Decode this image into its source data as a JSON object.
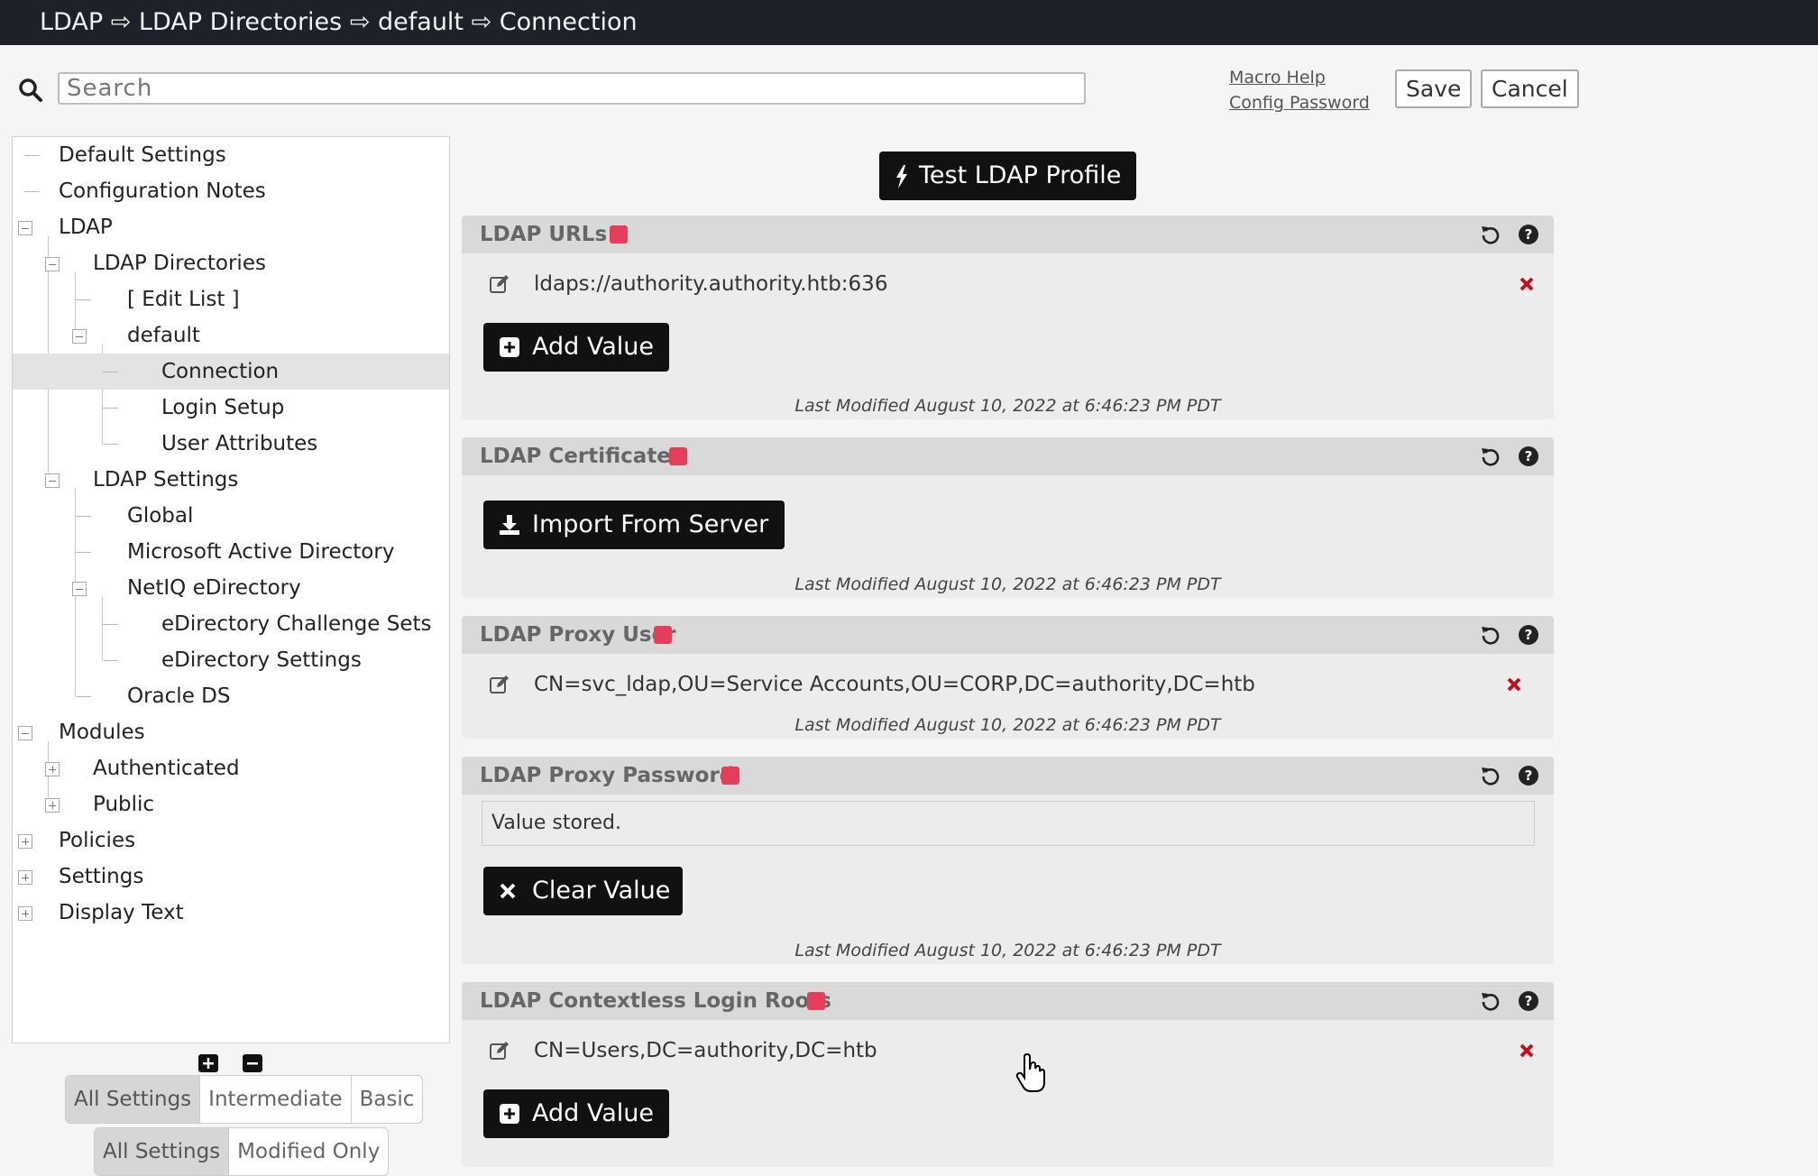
{
  "breadcrumb": "LDAP ⇨ LDAP Directories ⇨ default ⇨ Connection",
  "search": {
    "placeholder": "Search"
  },
  "header_links": {
    "macro_help": "Macro Help",
    "config_password": "Config Password"
  },
  "header_buttons": {
    "save": "Save",
    "cancel": "Cancel"
  },
  "tree": [
    {
      "label": "Default Settings",
      "level": 0,
      "toggle": "none"
    },
    {
      "label": "Configuration Notes",
      "level": 0,
      "toggle": "none"
    },
    {
      "label": "LDAP",
      "level": 0,
      "toggle": "minus"
    },
    {
      "label": "LDAP Directories",
      "level": 1,
      "toggle": "minus"
    },
    {
      "label": "[ Edit List ]",
      "level": 2,
      "toggle": "none"
    },
    {
      "label": "default",
      "level": 2,
      "toggle": "minus"
    },
    {
      "label": "Connection",
      "level": 3,
      "toggle": "none",
      "selected": true
    },
    {
      "label": "Login Setup",
      "level": 3,
      "toggle": "none"
    },
    {
      "label": "User Attributes",
      "level": 3,
      "toggle": "none"
    },
    {
      "label": "LDAP Settings",
      "level": 1,
      "toggle": "minus"
    },
    {
      "label": "Global",
      "level": 2,
      "toggle": "none"
    },
    {
      "label": "Microsoft Active Directory",
      "level": 2,
      "toggle": "none"
    },
    {
      "label": "NetIQ eDirectory",
      "level": 2,
      "toggle": "minus"
    },
    {
      "label": "eDirectory Challenge Sets",
      "level": 3,
      "toggle": "none"
    },
    {
      "label": "eDirectory Settings",
      "level": 3,
      "toggle": "none"
    },
    {
      "label": "Oracle DS",
      "level": 2,
      "toggle": "none"
    },
    {
      "label": "Modules",
      "level": 0,
      "toggle": "minus"
    },
    {
      "label": "Authenticated",
      "level": 1,
      "toggle": "plus"
    },
    {
      "label": "Public",
      "level": 1,
      "toggle": "plus"
    },
    {
      "label": "Policies",
      "level": 0,
      "toggle": "plus"
    },
    {
      "label": "Settings",
      "level": 0,
      "toggle": "plus"
    },
    {
      "label": "Display Text",
      "level": 0,
      "toggle": "plus"
    }
  ],
  "level_filter": {
    "options": [
      "All Settings",
      "Intermediate",
      "Basic"
    ],
    "selected": "All Settings"
  },
  "modified_filter": {
    "options": [
      "All Settings",
      "Modified Only"
    ],
    "selected": "All Settings"
  },
  "test_button": "Test LDAP Profile",
  "panels": {
    "urls": {
      "title": "LDAP URLs",
      "value": "ldaps://authority.authority.htb:636",
      "button": "Add Value",
      "modified": "Last Modified August 10, 2022 at 6:46:23 PM PDT"
    },
    "certificates": {
      "title": "LDAP Certificates",
      "button": "Import From Server",
      "modified": "Last Modified August 10, 2022 at 6:46:23 PM PDT"
    },
    "proxy_user": {
      "title": "LDAP Proxy User",
      "value": "CN=svc_ldap,OU=Service Accounts,OU=CORP,DC=authority,DC=htb",
      "modified": "Last Modified August 10, 2022 at 6:46:23 PM PDT"
    },
    "proxy_password": {
      "title": "LDAP Proxy Password",
      "value": "Value stored.",
      "button": "Clear Value",
      "modified": "Last Modified August 10, 2022 at 6:46:23 PM PDT"
    },
    "contextless_roots": {
      "title": "LDAP Contextless Login Roots",
      "value": "CN=Users,DC=authority,DC=htb",
      "button": "Add Value"
    }
  },
  "colors": {
    "titlebar": "#1e2129",
    "edit_badge": "#e53e5c",
    "delete": "#c0121e",
    "button": "#111111",
    "panel": "#ececec",
    "panel_header": "#d9d9d9"
  }
}
